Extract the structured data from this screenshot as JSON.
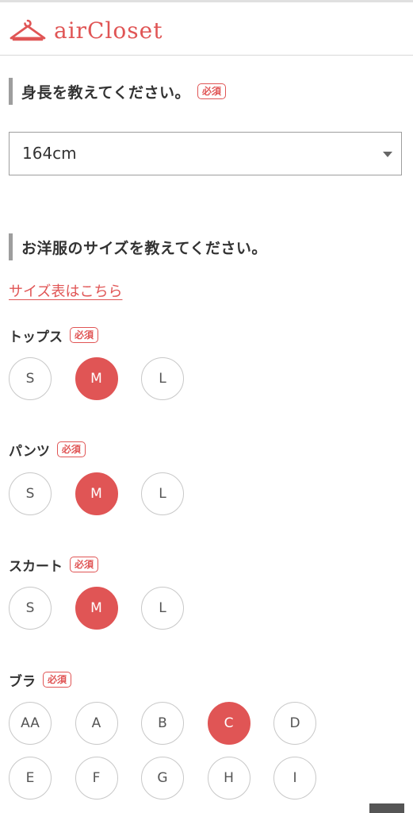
{
  "brand": {
    "name": "airCloset"
  },
  "height_section": {
    "title": "身長を教えてください。",
    "badge": "必須",
    "selected_value": "164cm"
  },
  "size_section": {
    "title": "お洋服のサイズを教えてください。",
    "size_chart_link": "サイズ表はこちら",
    "groups": [
      {
        "label": "トップス",
        "badge": "必須",
        "options": [
          "S",
          "M",
          "L"
        ],
        "selected": "M"
      },
      {
        "label": "パンツ",
        "badge": "必須",
        "options": [
          "S",
          "M",
          "L"
        ],
        "selected": "M"
      },
      {
        "label": "スカート",
        "badge": "必須",
        "options": [
          "S",
          "M",
          "L"
        ],
        "selected": "M"
      },
      {
        "label": "ブラ",
        "badge": "必須",
        "options": [
          "AA",
          "A",
          "B",
          "C",
          "D",
          "E",
          "F",
          "G",
          "H",
          "I"
        ],
        "selected": "C"
      }
    ]
  },
  "colors": {
    "accent": "#e05555",
    "border": "#c8c8c8",
    "bar": "#9e9e9e"
  }
}
